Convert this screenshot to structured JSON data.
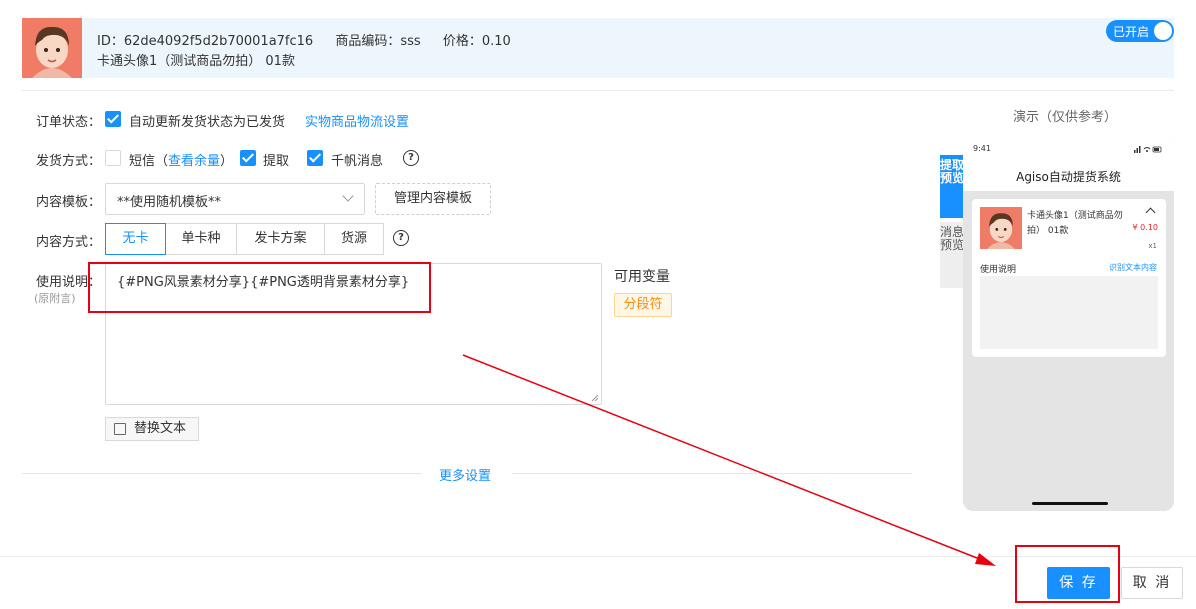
{
  "header": {
    "id_text": "ID：62de4092f5d2b70001a7fc16",
    "code_text": "商品编码：sss",
    "price_text": "价格：0.10",
    "product_name": "卡通头像1（测试商品勿拍） 01款",
    "toggle_label": "已开启"
  },
  "form": {
    "order_status_label": "订单状态：",
    "auto_update_label": "自动更新发货状态为已发货",
    "logistics_link": "实物商品物流设置",
    "delivery_label": "发货方式：",
    "sms_label": "短信",
    "sms_balance_open": "（",
    "sms_balance_link": "查看余量",
    "sms_balance_close": "）",
    "pickup_label": "提取",
    "qianfan_label": "千帆消息",
    "template_label": "内容模板：",
    "template_value": "**使用随机模板**",
    "manage_template_button": "管理内容模板",
    "content_mode_label": "内容方式：",
    "modes": [
      "无卡",
      "单卡种",
      "发卡方案",
      "货源"
    ],
    "usage_label": "使用说明：",
    "usage_sub_label": "(原附言)",
    "usage_content": "{#PNG风景素材分享}{#PNG透明背景素材分享}",
    "variables_title": "可用变量",
    "variable_tag": "分段符",
    "replace_text_button": "替换文本",
    "more_settings_link": "更多设置"
  },
  "preview": {
    "title": "演示（仅供参考）",
    "tab_pickup": "提取预览",
    "tab_message": "消息预览",
    "phone_time": "9:41",
    "app_title": "Agiso自动提货系统",
    "item_name": "卡通头像1（测试商品勿拍） 01款",
    "item_price": "¥ 0.10",
    "item_qty": "x1",
    "usage_label": "使用说明",
    "copy_link": "识别文本内容"
  },
  "footer": {
    "save_button": "保 存",
    "cancel_button": "取 消"
  },
  "colors": {
    "primary": "#1890ff",
    "annotation_red": "#e60012",
    "tag_orange": "#fa8c16"
  }
}
